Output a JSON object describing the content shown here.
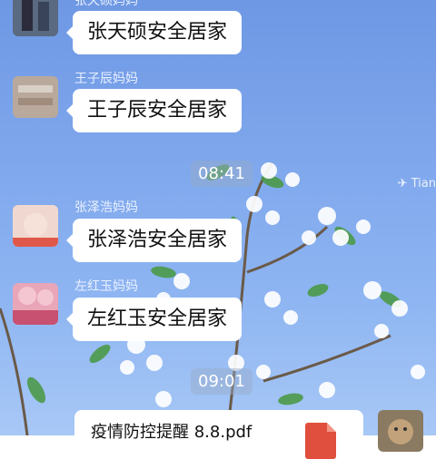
{
  "messages": [
    {
      "sender": "张天硕妈妈",
      "text": "张天硕安全居家"
    },
    {
      "sender": "王子辰妈妈",
      "text": "王子辰安全居家"
    },
    {
      "sender": "张泽浩妈妈",
      "text": "张泽浩安全居家"
    },
    {
      "sender": "左红玉妈妈",
      "text": "左红玉安全居家"
    }
  ],
  "timestamps": [
    "08:41",
    "09:01"
  ],
  "file_message": {
    "filename": "疫情防控提醒 8.8.pdf",
    "icon": "pdf-file-icon"
  },
  "watermark": "✈ Tian",
  "colors": {
    "background": "#7ea6ec",
    "bubble": "#ffffff",
    "pdf": "#e04f3d"
  }
}
